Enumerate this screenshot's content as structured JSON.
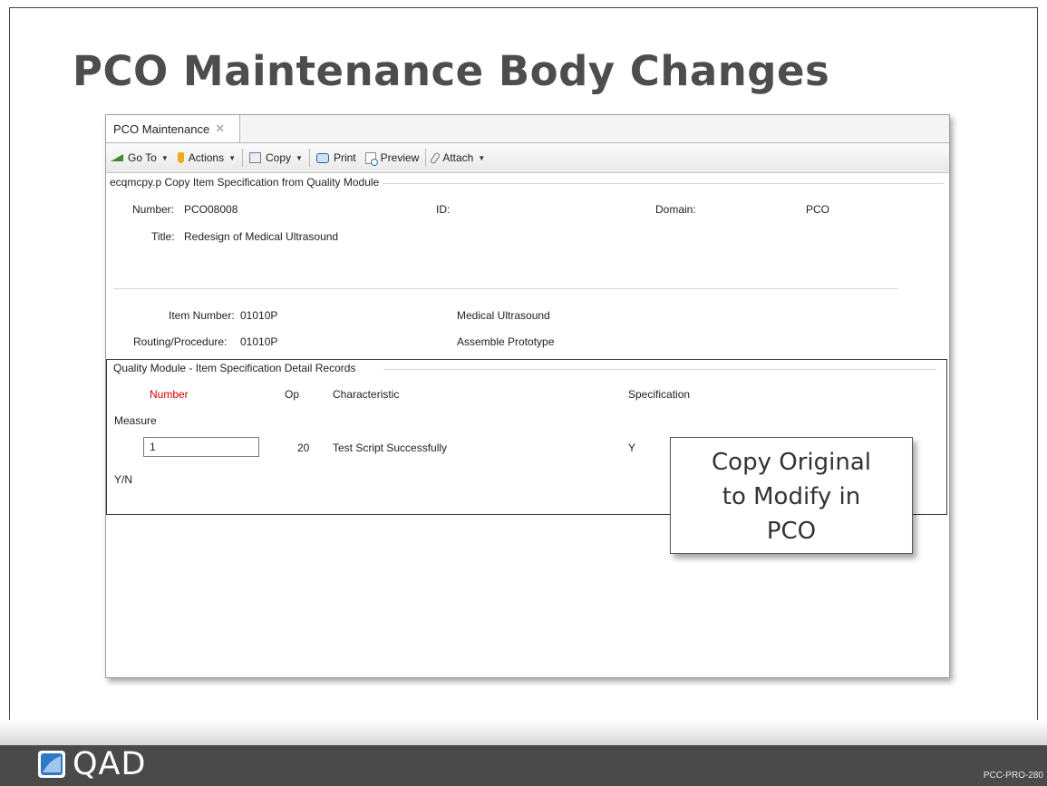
{
  "slide": {
    "title": "PCO Maintenance Body Changes",
    "code": "PCC-PRO-280"
  },
  "window": {
    "tab": {
      "label": "PCO Maintenance",
      "close": "✕"
    },
    "toolbar": {
      "goto": "Go To",
      "actions": "Actions",
      "copy": "Copy",
      "print": "Print",
      "preview": "Preview",
      "attach": "Attach"
    },
    "header": {
      "group_label": "ecqmcpy.p  Copy Item Specification from Quality Module",
      "number_label": "Number:",
      "number_value": "PCO08008",
      "id_label": "ID:",
      "domain_label": "Domain:",
      "domain_value": "PCO",
      "title_label": "Title:",
      "title_value": "Redesign of Medical Ultrasound",
      "item_number_label": "Item Number:",
      "item_number_value": "01010P",
      "item_description": "Medical Ultrasound",
      "routing_label": "Routing/Procedure:",
      "routing_value": "01010P",
      "routing_description": "Assemble Prototype"
    },
    "detail": {
      "group_label": "Quality Module - Item Specification Detail Records",
      "columns": {
        "number": "Number",
        "op": "Op",
        "characteristic": "Characteristic",
        "specification": "Specification"
      },
      "measure_label": "Measure",
      "row": {
        "number": "1",
        "op": "20",
        "characteristic": "Test Script Successfully",
        "specification": "Y"
      },
      "yn_label": "Y/N"
    }
  },
  "callout": {
    "line1": "Copy Original",
    "line2": "to Modify in",
    "line3": "PCO"
  },
  "footer": {
    "logo_text": "QAD"
  },
  "colors": {
    "title": "#4d4d4d",
    "number_header": "#cc0000",
    "footer_bar": "#4a4a4a",
    "logo_blue": "#2f78c4"
  }
}
